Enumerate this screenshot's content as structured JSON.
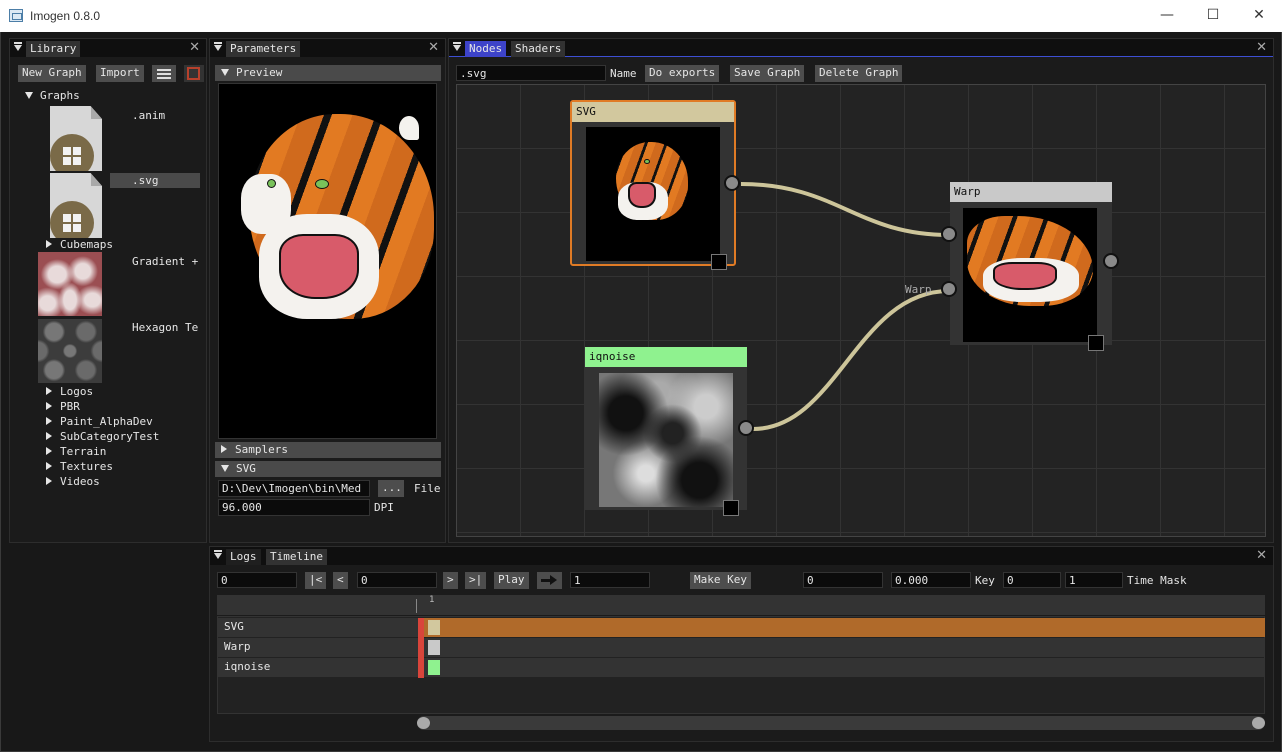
{
  "window": {
    "title": "Imogen 0.8.0",
    "controls": [
      "minimize-icon",
      "maximize-icon",
      "close-icon"
    ]
  },
  "library": {
    "tab": "Library",
    "buttons": {
      "new_graph": "New Graph",
      "import": "Import"
    },
    "tree": {
      "graphs_label": "Graphs",
      "graphs": [
        ".anim",
        ".svg",
        "Gradient +",
        "Hexagon Te"
      ],
      "selected": ".svg",
      "folders": [
        "Cubemaps",
        "Logos",
        "PBR",
        "Paint_AlphaDev",
        "SubCategoryTest",
        "Terrain",
        "Textures",
        "Videos"
      ]
    }
  },
  "parameters": {
    "tab": "Parameters",
    "preview_header": "Preview",
    "samplers_header": "Samplers",
    "svg_header": "SVG",
    "file_path": "D:\\Dev\\Imogen\\bin\\Med",
    "browse_button": "...",
    "file_label": "File",
    "dpi_value": "96.000",
    "dpi_label": "DPI"
  },
  "nodes_panel": {
    "tabs": [
      "Nodes",
      "Shaders"
    ],
    "active_tab": "Nodes",
    "graph_name": ".svg",
    "name_label": "Name",
    "buttons": {
      "do_exports": "Do exports",
      "save_graph": "Save Graph",
      "delete_graph": "Delete Graph"
    },
    "nodes": [
      {
        "title": "SVG",
        "color": "#d2c89e",
        "selected": true,
        "accent": "#e07b25"
      },
      {
        "title": "Warp",
        "color": "#c9c9c9",
        "input_label": "Warp"
      },
      {
        "title": "iqnoise",
        "color": "#8ff28f"
      }
    ],
    "link_color": "#cdc59a"
  },
  "bottom_panel": {
    "tabs": [
      "Logs",
      "Timeline"
    ],
    "active_tab": "Timeline",
    "controls": {
      "frame": "0",
      "first": "|<",
      "prev": "<",
      "current": "0",
      "next": ">",
      "last": ">|",
      "play": "Play",
      "speed": "1",
      "make_key": "Make Key",
      "key_frame": "0",
      "key_value": "0.000",
      "key_label": "Key",
      "time_start": "0",
      "time_end": "1",
      "time_mask_label": "Time Mask"
    },
    "ruler_tick": "1",
    "tracks": [
      {
        "name": "SVG",
        "color": "#b06a2a",
        "key_color": "#d2c89e",
        "highlight": true
      },
      {
        "name": "Warp",
        "color": "#333333",
        "key_color": "#c9c9c9"
      },
      {
        "name": "iqnoise",
        "color": "#333333",
        "key_color": "#8ff28f"
      }
    ]
  }
}
